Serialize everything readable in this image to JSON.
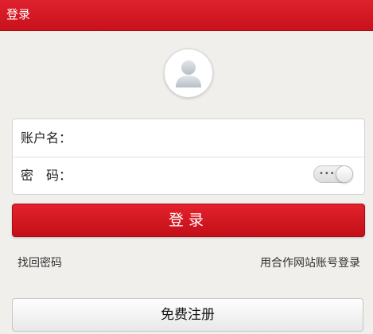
{
  "header": {
    "title": "登录"
  },
  "avatar": {
    "icon": "user-avatar-icon"
  },
  "form": {
    "account_label": "账户名：",
    "account_value": "",
    "password_label": "密　码：",
    "password_value": "",
    "password_toggle_dots": "•••"
  },
  "actions": {
    "login_label": "登录",
    "forgot_password": "找回密码",
    "partner_login": "用合作网站账号登录",
    "register_label": "免费注册"
  },
  "colors": {
    "header_red": "#d41a24",
    "login_red": "#d41a24",
    "background": "#f1efec"
  }
}
